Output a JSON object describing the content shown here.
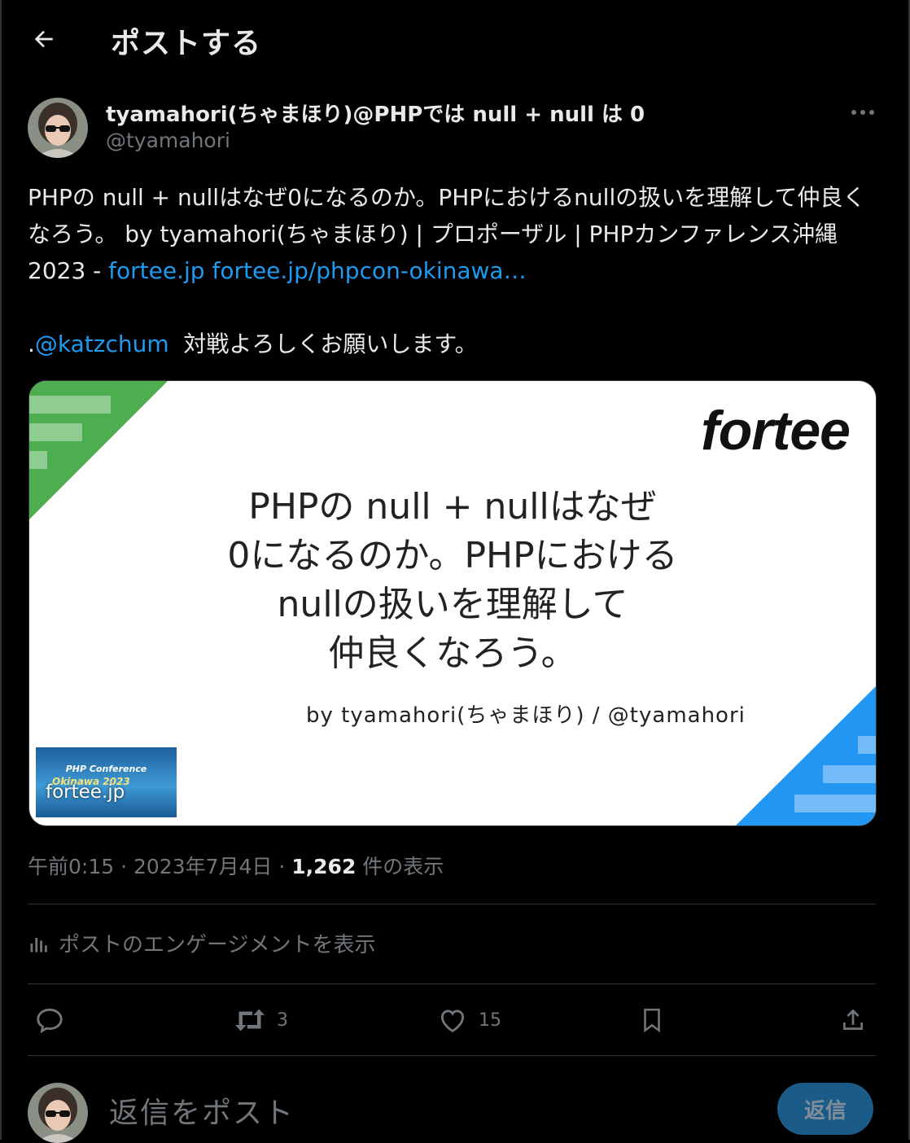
{
  "header": {
    "title": "ポストする"
  },
  "author": {
    "name": "tyamahori(ちゃまほり)@PHPでは null + null は 0",
    "handle": "@tyamahori"
  },
  "post": {
    "text_part1": "PHPの null + nullはなぜ0になるのか。PHPにおけるnullの扱いを理解して仲良くなろう。 by tyamahori(ちゃまほり) | プロポーザル | PHPカンファレンス沖縄2023 - ",
    "link1": "fortee.jp",
    "link2": "fortee.jp/phpcon-okinawa…",
    "mention_prefix": ".",
    "mention": "@katzchum",
    "text_part2": " 対戦よろしくお願いします。"
  },
  "card": {
    "logo": "fortee",
    "title_line1": "PHPの null + nullはなぜ",
    "title_line2": "0になるのか。PHPにおける",
    "title_line3": "nullの扱いを理解して",
    "title_line4": "仲良くなろう。",
    "byline": "by tyamahori(ちゃまほり) / @tyamahori",
    "thumb_text1": "PHP Conference",
    "thumb_text2": "Okinawa 2023",
    "domain": "fortee.jp",
    "colors": {
      "green": "#4cae4f",
      "green_light": "#a5d6a7",
      "blue": "#2196f3",
      "blue_light": "#90caf9"
    }
  },
  "meta": {
    "time": "午前0:15",
    "sep1": " · ",
    "date": "2023年7月4日",
    "sep2": " · ",
    "views": "1,262",
    "views_label": " 件の表示"
  },
  "engagement": {
    "label": "ポストのエンゲージメントを表示",
    "icon": "analytics-icon"
  },
  "actions": {
    "reply_count": "",
    "repost_count": "3",
    "like_count": "15"
  },
  "reply": {
    "placeholder": "返信をポスト",
    "button": "返信"
  },
  "colors": {
    "accent": "#1d9bf0",
    "muted": "#71767b",
    "background": "#000000"
  }
}
